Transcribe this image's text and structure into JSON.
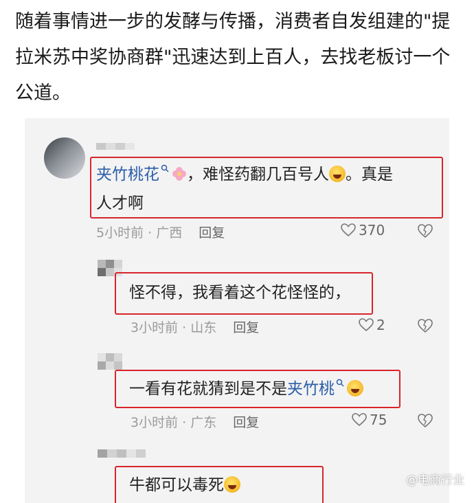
{
  "article": {
    "text": "随着事情进一步的发酵与传播，消费者自发组建的\"提拉米苏中奖协商群\"迅速达到上百人，去找老板讨一个公道。"
  },
  "comments": [
    {
      "username": "夹竹桃花",
      "text_after": "，难怪药翻几百号人",
      "text_tail": "。真是",
      "text_line2": "人才啊",
      "time": "5小时前",
      "location": "广西",
      "reply": "回复",
      "likes": "370"
    },
    {
      "text": "怪不得，我看着这个花怪怪的，",
      "time": "3小时前",
      "location": "山东",
      "reply": "回复",
      "likes": "2"
    },
    {
      "text": "一看有花就猜到是不是",
      "username": "夹竹桃",
      "time": "3小时前",
      "location": "广东",
      "reply": "回复",
      "likes": "75"
    },
    {
      "text": "牛都可以毒死"
    }
  ],
  "watermark": "@电商行业",
  "icons": [
    "search-icon",
    "flower-emoji",
    "laughing-emoji",
    "heart-icon",
    "dislike-icon"
  ],
  "colors": {
    "highlight_box": "#d8242a",
    "username": "#2b5ea8"
  }
}
